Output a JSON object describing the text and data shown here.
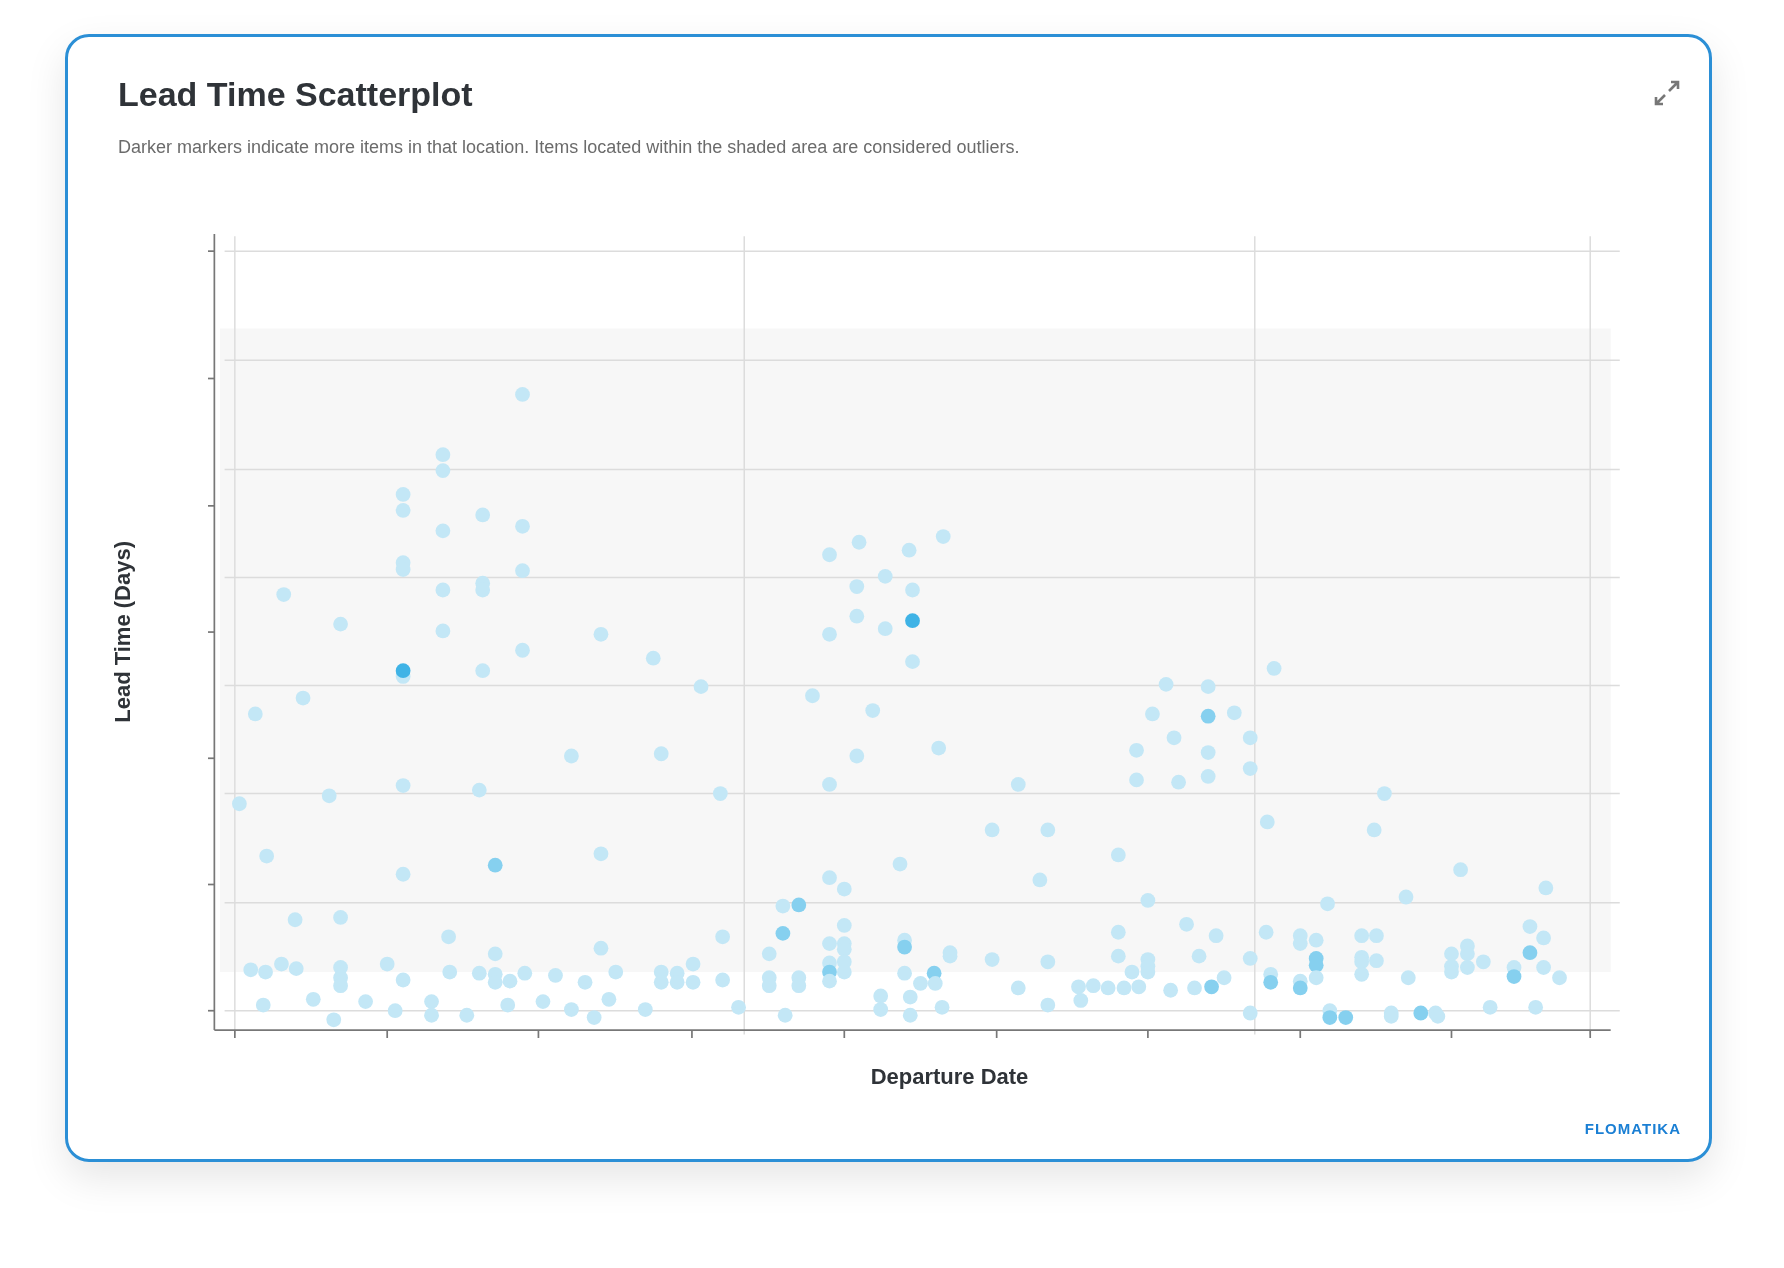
{
  "card": {
    "title": "Lead Time Scatterplot",
    "subtitle": "Darker markers indicate more items in that location. Items located within the shaded area are considered outliers.",
    "chart": {
      "y_axis_label": "Lead Time (Days)",
      "x_axis_label": "Departure Date"
    },
    "logo": "FLOMATIKA"
  }
}
